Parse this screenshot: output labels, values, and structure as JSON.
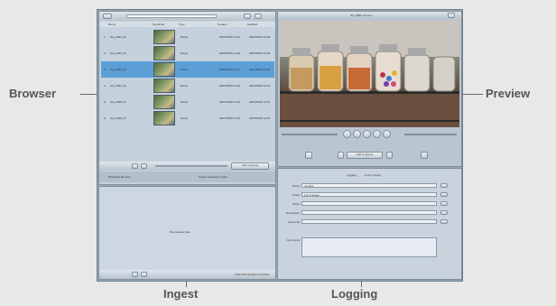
{
  "callouts": {
    "browser": "Browser",
    "preview": "Preview",
    "ingest": "Ingest",
    "logging": "Logging"
  },
  "browser": {
    "columns": [
      "Name",
      "Thumbnail",
      "Type",
      "Created",
      "Modified"
    ],
    "rows": [
      {
        "num": "1",
        "name": "clip_0001_01",
        "type": "Movie",
        "created": "2007/05/05 11:01",
        "modified": "2007/05/05 11:03"
      },
      {
        "num": "2",
        "name": "clip_0002_01",
        "type": "Movie",
        "created": "2007/05/05 11:04",
        "modified": "2007/05/05 11:06"
      },
      {
        "num": "3",
        "name": "clip_0003_01",
        "type": "Movie",
        "created": "2007/05/05 11:07",
        "modified": "2007/05/05 11:09"
      },
      {
        "num": "4",
        "name": "clip_0004_01",
        "type": "Movie",
        "created": "2007/05/05 11:10",
        "modified": "2007/05/05 11:12"
      },
      {
        "num": "5",
        "name": "clip_0005_01",
        "type": "Movie",
        "created": "2007/05/05 11:13",
        "modified": "2007/05/05 11:15"
      },
      {
        "num": "6",
        "name": "clip_0006_01",
        "type": "Movie",
        "created": "2007/05/05 11:16",
        "modified": "2007/05/05 11:18"
      }
    ],
    "selected_index": 2,
    "status": "Browsing: Remote",
    "items_info": "6 items selected, 6 total",
    "search_placeholder": "Add to Queue"
  },
  "ingest": {
    "drop_text": "Drop assets here",
    "footer_text": "Total Files Ready: 0 of 0 files"
  },
  "preview": {
    "title": "clip_0003_01.mov",
    "add_button": "Add to Queue"
  },
  "logging": {
    "tabs": [
      "Logging",
      "Link to Group"
    ],
    "fields": [
      {
        "label": "Name",
        "value": "Jennifer"
      },
      {
        "label": "Group",
        "value": "Fun Footage"
      },
      {
        "label": "Roles",
        "value": ""
      },
      {
        "label": "Description",
        "value": ""
      },
      {
        "label": "Keywords",
        "value": ""
      },
      {
        "label": "Comments",
        "value": ""
      }
    ]
  }
}
